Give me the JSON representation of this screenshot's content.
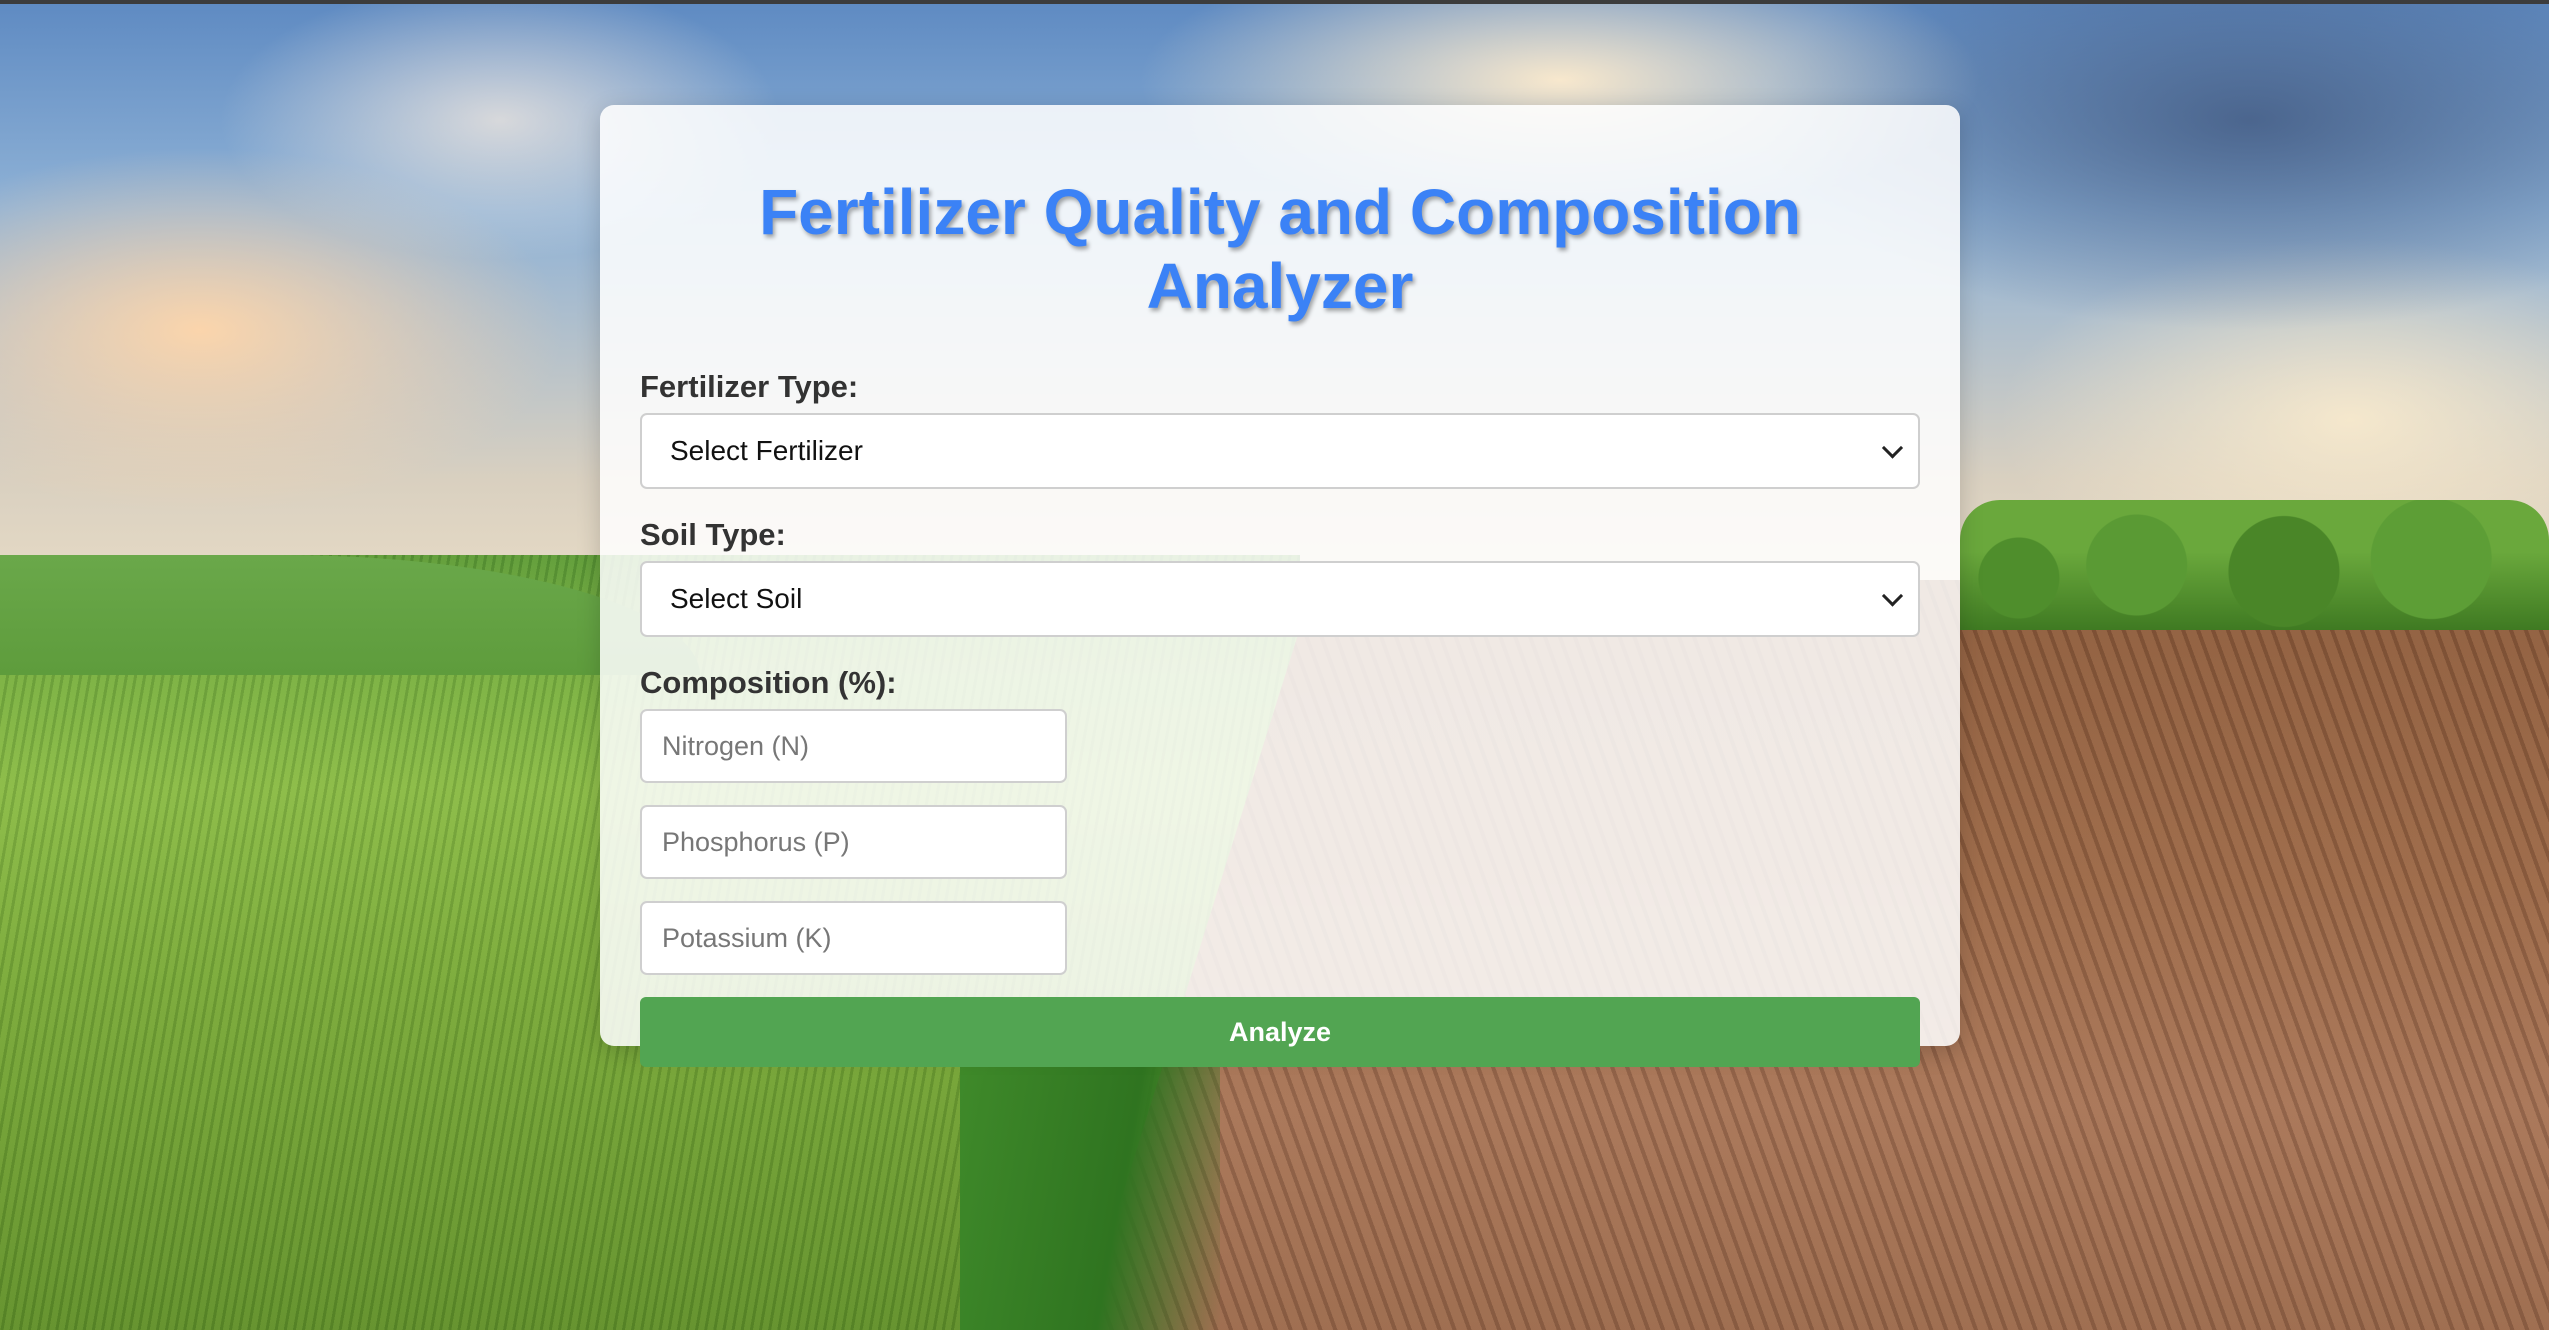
{
  "app": {
    "title": "Fertilizer Quality and Composition Analyzer"
  },
  "form": {
    "fertilizer": {
      "label": "Fertilizer Type:",
      "selected": "Select Fertilizer"
    },
    "soil": {
      "label": "Soil Type:",
      "selected": "Select Soil"
    },
    "composition": {
      "label": "Composition (%):",
      "nitrogen_placeholder": "Nitrogen (N)",
      "phosphorus_placeholder": "Phosphorus (P)",
      "potassium_placeholder": "Potassium (K)"
    },
    "submit_label": "Analyze"
  },
  "colors": {
    "title": "#3b82f6",
    "button": "#52a552"
  },
  "icons": {
    "select_arrow": "chevron-down-icon"
  }
}
